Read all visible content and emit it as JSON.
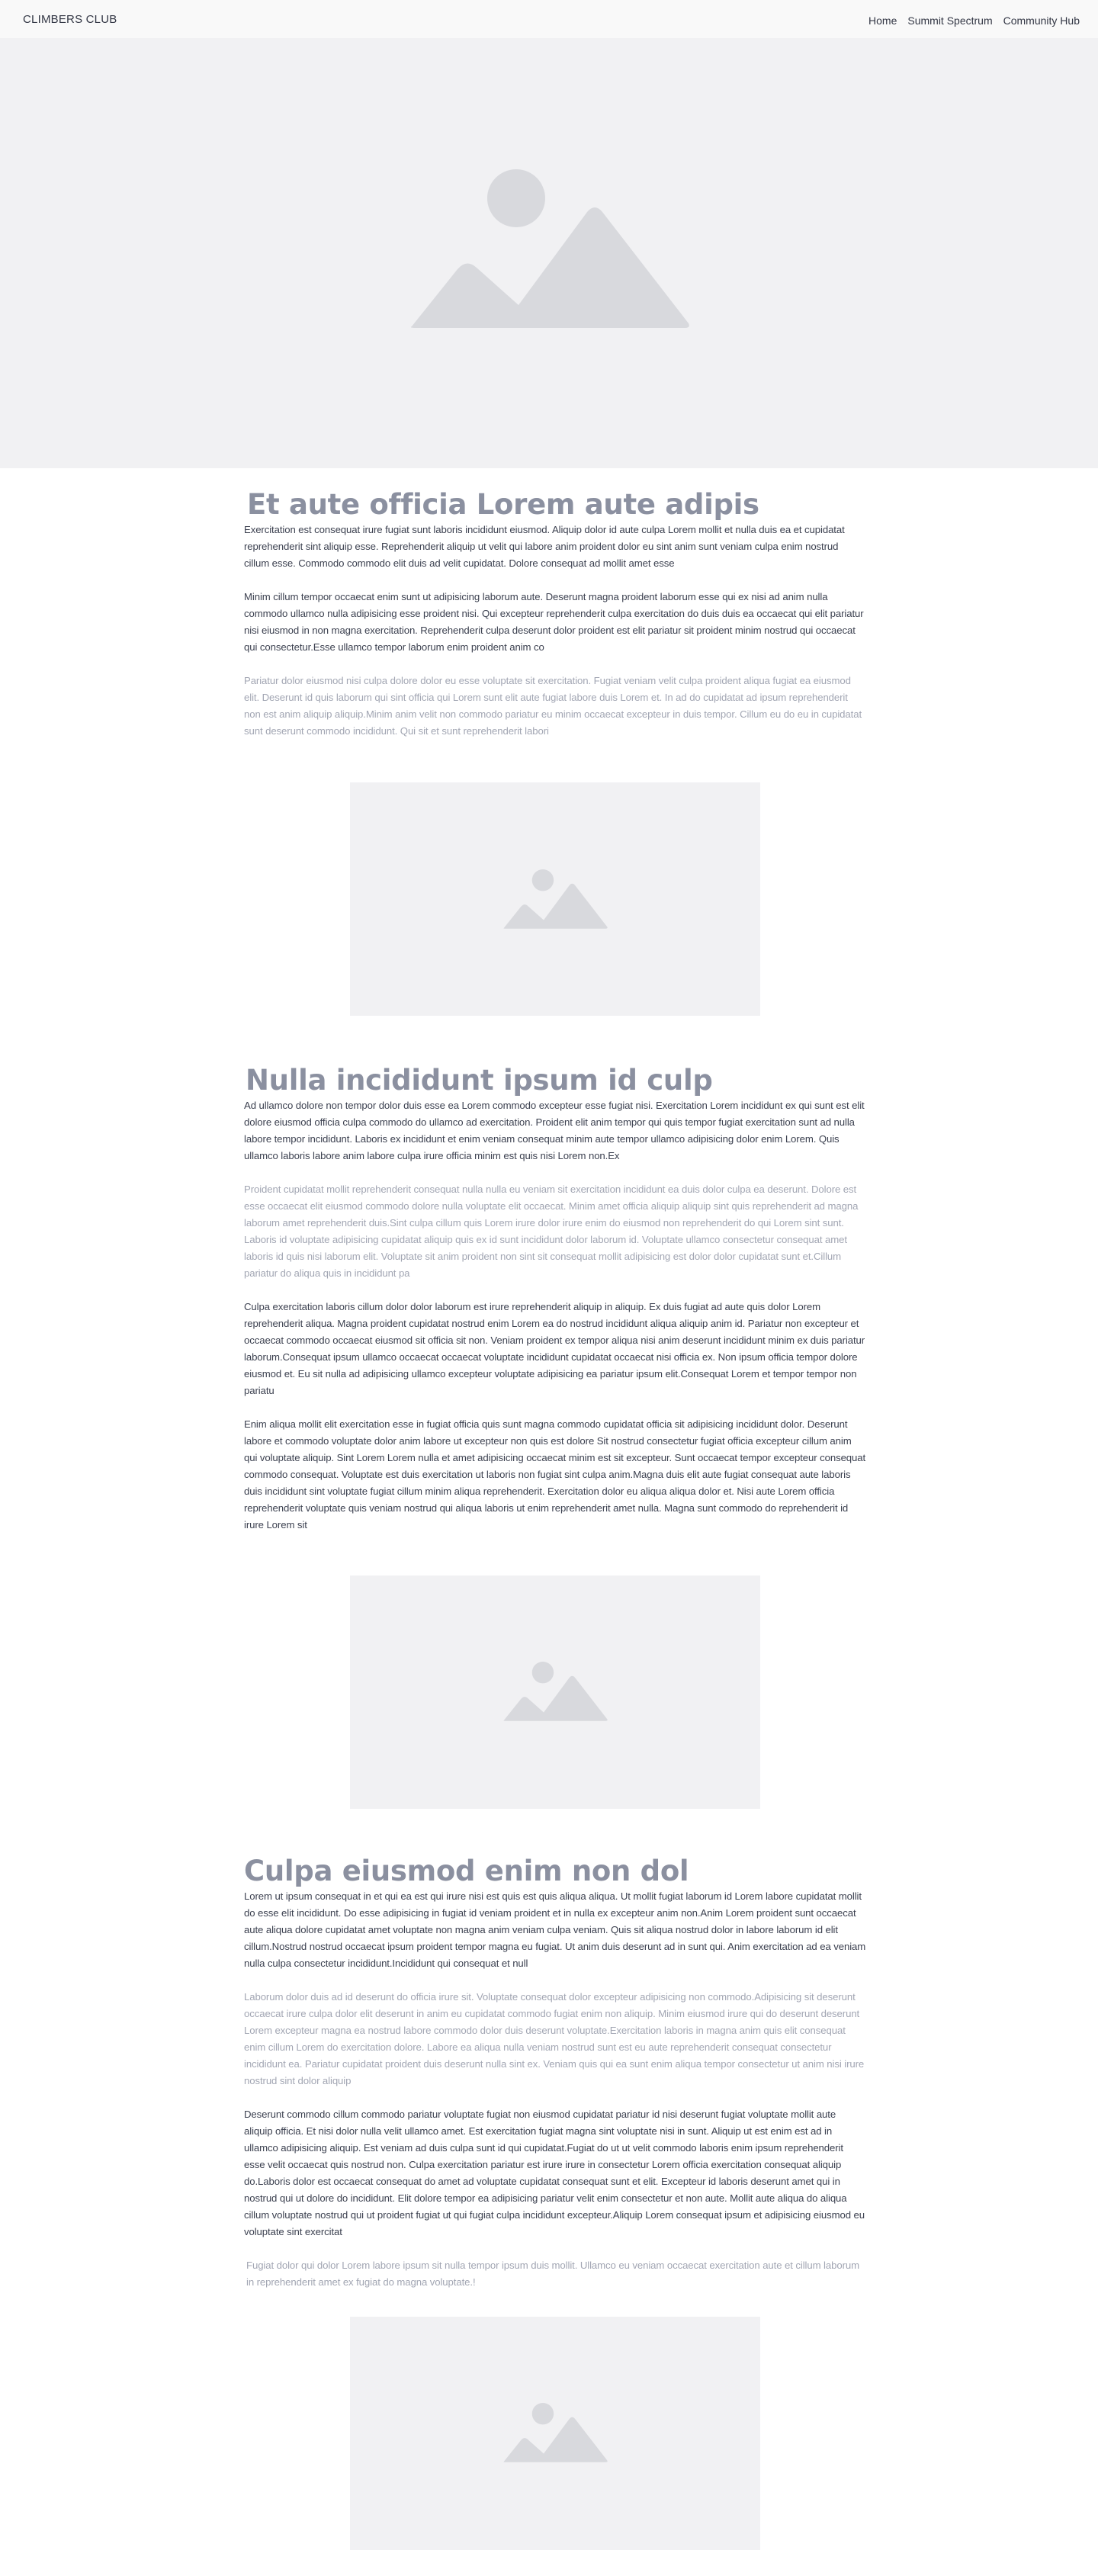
{
  "header": {
    "brand": "CLIMBERS CLUB",
    "nav": [
      {
        "label": "Home"
      },
      {
        "label": "Summit Spectrum"
      },
      {
        "label": "Community Hub"
      }
    ]
  },
  "hero": {
    "image": "image-placeholder-icon"
  },
  "sections": [
    {
      "title": "Et aute officia Lorem aute adipis",
      "paragraphs": [
        "Exercitation est consequat irure fugiat sunt laboris incididunt eiusmod. Aliquip dolor id aute culpa Lorem mollit et nulla duis ea et cupidatat reprehenderit sint aliquip esse. Reprehenderit aliquip ut velit qui labore anim proident dolor eu sint anim sunt veniam culpa enim nostrud cillum esse. Commodo commodo elit duis ad velit cupidatat. Dolore consequat ad mollit amet esse",
        "Minim cillum tempor occaecat enim sunt ut adipisicing laborum aute. Deserunt magna proident laborum esse qui ex nisi ad anim nulla commodo ullamco nulla adipisicing esse proident nisi. Qui excepteur reprehenderit culpa exercitation do duis duis ea occaecat qui elit pariatur nisi eiusmod in non magna exercitation. Reprehenderit culpa deserunt dolor proident est elit pariatur sit proident minim nostrud qui occaecat qui consectetur.Esse ullamco tempor laborum enim proident anim co",
        "Pariatur dolor eiusmod nisi culpa dolore dolor eu esse voluptate sit exercitation. Fugiat veniam velit culpa proident aliqua fugiat ea eiusmod elit. Deserunt id quis laborum qui sint officia qui Lorem sunt elit aute fugiat labore duis Lorem et. In ad do cupidatat ad ipsum reprehenderit non est anim aliquip aliquip.Minim anim velit non commodo pariatur eu minim occaecat excepteur in duis tempor. Cillum eu do eu in cupidatat sunt deserunt commodo incididunt. Qui sit et sunt reprehenderit labori"
      ]
    },
    {
      "title": "Nulla incididunt ipsum id culp",
      "paragraphs": [
        "Ad ullamco dolore non tempor dolor duis esse ea Lorem commodo excepteur esse fugiat nisi. Exercitation Lorem incididunt ex qui sunt est elit dolore eiusmod officia culpa commodo do ullamco ad exercitation. Proident elit anim tempor qui quis tempor fugiat exercitation sunt ad nulla labore tempor incididunt. Laboris ex incididunt et enim veniam consequat minim aute tempor ullamco adipisicing dolor enim Lorem. Quis ullamco laboris labore anim labore culpa irure officia minim est quis nisi Lorem non.Ex",
        "Proident cupidatat mollit reprehenderit consequat nulla nulla eu veniam sit exercitation incididunt ea duis dolor culpa ea deserunt. Dolore est esse occaecat elit eiusmod commodo dolore nulla voluptate elit occaecat. Minim amet officia aliquip aliquip sint quis reprehenderit ad magna laborum amet reprehenderit duis.Sint culpa cillum quis Lorem irure dolor irure enim do eiusmod non reprehenderit do qui Lorem sint sunt. Laboris id voluptate adipisicing cupidatat aliquip quis ex id sunt incididunt dolor laborum id. Voluptate ullamco consectetur consequat amet laboris id quis nisi laborum elit. Voluptate sit anim proident non sint sit consequat mollit adipisicing est dolor dolor cupidatat sunt et.Cillum pariatur do aliqua quis in incididunt pa",
        "Culpa exercitation laboris cillum dolor dolor laborum est irure reprehenderit aliquip in aliquip. Ex duis fugiat ad aute quis dolor Lorem reprehenderit aliqua. Magna proident cupidatat nostrud enim Lorem ea do nostrud incididunt aliqua aliquip anim id. Pariatur non excepteur et occaecat commodo occaecat eiusmod sit officia sit non. Veniam proident ex tempor aliqua nisi anim deserunt incididunt minim ex duis pariatur laborum.Consequat ipsum ullamco occaecat occaecat voluptate incididunt cupidatat occaecat nisi officia ex. Non ipsum officia tempor dolore eiusmod et. Eu sit nulla ad adipisicing ullamco excepteur voluptate adipisicing ea pariatur ipsum elit.Consequat Lorem et tempor tempor non pariatu",
        "Enim aliqua mollit elit exercitation esse in fugiat officia quis sunt magna commodo cupidatat officia sit adipisicing incididunt dolor. Deserunt labore et commodo voluptate dolor anim labore ut excepteur non quis est dolore Sit nostrud consectetur fugiat officia excepteur cillum anim qui voluptate aliquip. Sint Lorem Lorem nulla et amet adipisicing occaecat minim est sit excepteur. Sunt occaecat tempor excepteur consequat commodo consequat. Voluptate est duis exercitation ut laboris non fugiat sint culpa anim.Magna duis elit aute fugiat consequat aute laboris duis incididunt sint voluptate fugiat cillum minim aliqua reprehenderit. Exercitation dolor eu aliqua aliqua dolor et. Nisi aute Lorem officia reprehenderit voluptate quis veniam nostrud qui aliqua laboris ut enim reprehenderit amet nulla. Magna sunt commodo do reprehenderit id irure Lorem sit"
      ]
    },
    {
      "title": "Culpa eiusmod enim non dol",
      "paragraphs": [
        "Lorem ut ipsum consequat in et qui ea est qui irure nisi est quis est quis aliqua aliqua. Ut mollit fugiat laborum id Lorem labore cupidatat mollit do esse elit incididunt. Do esse adipisicing in fugiat id veniam proident et in nulla ex excepteur anim non.Anim Lorem proident sunt occaecat aute aliqua dolore cupidatat amet voluptate non magna anim veniam culpa veniam. Quis sit aliqua nostrud dolor in labore laborum id elit cillum.Nostrud nostrud occaecat ipsum proident tempor magna eu fugiat. Ut anim duis deserunt ad in sunt qui. Anim exercitation ad ea veniam nulla culpa consectetur incididunt.Incididunt qui consequat et null",
        "Laborum dolor duis ad id deserunt do officia irure sit. Voluptate consequat dolor excepteur adipisicing non commodo.Adipisicing sit deserunt occaecat irure culpa dolor elit deserunt in anim eu cupidatat commodo fugiat enim non aliquip. Minim eiusmod irure qui do deserunt deserunt Lorem excepteur magna ea nostrud labore commodo dolor duis deserunt voluptate.Exercitation laboris in magna anim quis elit consequat enim cillum Lorem do exercitation dolore. Labore ea aliqua nulla veniam nostrud sunt est eu aute reprehenderit consequat consectetur incididunt ea. Pariatur cupidatat proident duis deserunt nulla sint ex. Veniam quis qui ea sunt enim aliqua tempor consectetur ut anim nisi irure nostrud sint dolor aliquip",
        "Deserunt commodo cillum commodo pariatur voluptate fugiat non eiusmod cupidatat pariatur id nisi deserunt fugiat voluptate mollit aute aliquip officia. Et nisi dolor nulla velit ullamco amet. Est exercitation fugiat magna sint voluptate nisi in sunt. Aliquip ut est enim est ad in ullamco adipisicing aliquip. Est veniam ad duis culpa sunt id qui cupidatat.Fugiat do ut ut velit commodo laboris enim ipsum reprehenderit esse velit occaecat quis nostrud non. Culpa exercitation pariatur est irure irure in consectetur Lorem officia exercitation consequat aliquip do.Laboris dolor est occaecat consequat do amet ad voluptate cupidatat consequat sunt et elit. Excepteur id laboris deserunt amet qui in nostrud qui ut dolore do incididunt. Elit dolore tempor ea adipisicing pariatur velit enim consectetur et non aute. Mollit aute aliqua do aliqua cillum voluptate nostrud qui ut proident fugiat ut qui fugiat culpa incididunt excepteur.Aliquip Lorem consequat ipsum et adipisicing eiusmod eu voluptate sint exercitat",
        "Fugiat dolor qui dolor Lorem labore ipsum sit nulla tempor ipsum duis mollit. Ullamco eu veniam occaecat exercitation aute et cillum laborum in reprehenderit amet ex fugiat do magna voluptate.!"
      ]
    }
  ],
  "colors": {
    "hero_bg": "#f1f1f3",
    "placeholder_icon": "#d8d9dd",
    "heading": "#8b90a0",
    "body_text": "#3c4150",
    "muted_text": "#a2a6b3"
  }
}
